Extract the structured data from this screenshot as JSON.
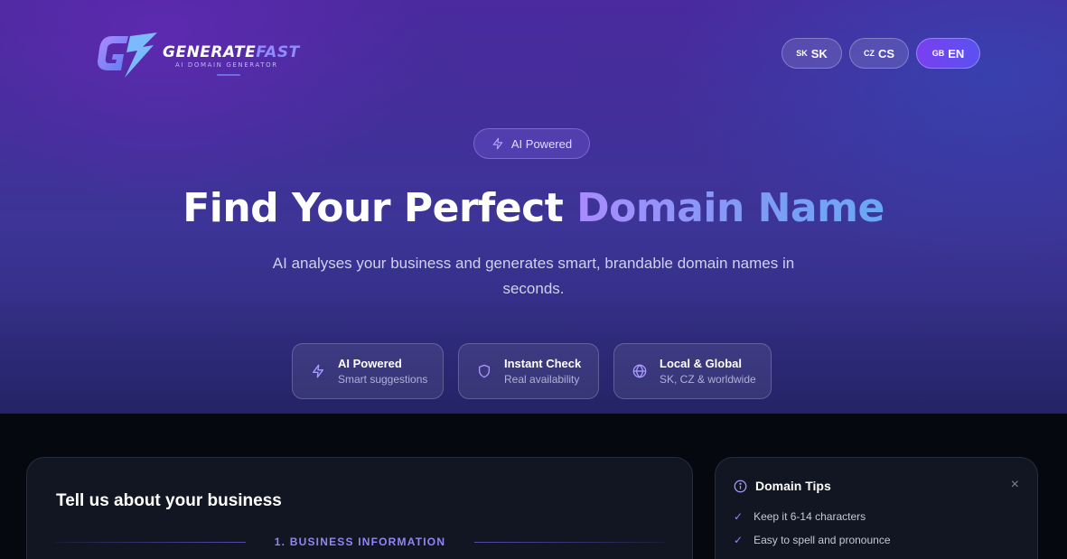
{
  "header": {
    "logo": {
      "name_part1": "GENERATE",
      "name_part2": "FAST",
      "tagline": "AI DOMAIN GENERATOR"
    },
    "languages": [
      {
        "flag": "SK",
        "label": "SK",
        "active": false
      },
      {
        "flag": "CZ",
        "label": "CS",
        "active": false
      },
      {
        "flag": "GB",
        "label": "EN",
        "active": true
      }
    ]
  },
  "hero": {
    "badge": "AI Powered",
    "headline_plain": "Find Your Perfect ",
    "headline_highlight": "Domain Name",
    "subtitle": "AI analyses your business and generates smart, brandable domain names in seconds.",
    "features": [
      {
        "icon": "lightning-icon",
        "title": "AI Powered",
        "subtitle": "Smart suggestions"
      },
      {
        "icon": "shield-icon",
        "title": "Instant Check",
        "subtitle": "Real availability"
      },
      {
        "icon": "globe-icon",
        "title": "Local & Global",
        "subtitle": "SK, CZ & worldwide"
      }
    ]
  },
  "main": {
    "title": "Tell us about your business",
    "section_label": "1. BUSINESS INFORMATION"
  },
  "tips": {
    "title": "Domain Tips",
    "close": "×",
    "items": [
      "Keep it 6-14 characters",
      "Easy to spell and pronounce"
    ]
  },
  "colors": {
    "accent": "#8f87f6",
    "hero_start": "#4a2a9e",
    "hero_end": "#2c2b78",
    "background": "#05080f"
  }
}
